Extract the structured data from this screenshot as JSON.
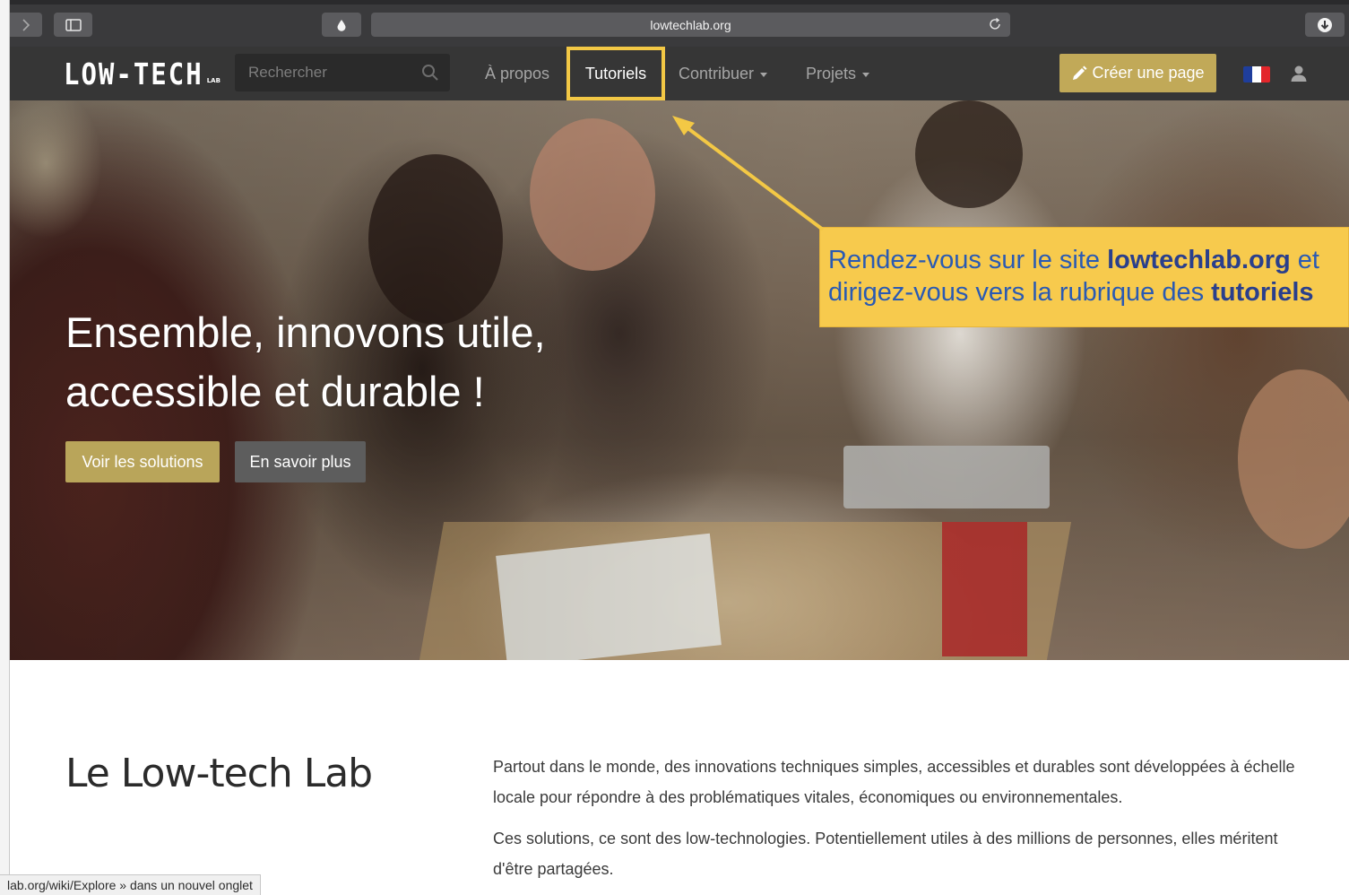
{
  "browser": {
    "url": "lowtechlab.org",
    "status_text": "lab.org/wiki/Explore » dans un nouvel onglet"
  },
  "header": {
    "logo_main": "LOW-TECH",
    "logo_sub": "LAB",
    "search_placeholder": "Rechercher",
    "nav": {
      "apropos": "À propos",
      "tutoriels": "Tutoriels",
      "contribuer": "Contribuer",
      "projets": "Projets"
    },
    "create_page": "Créer une page",
    "flag_colors": [
      "#1f3e9c",
      "#ffffff",
      "#e3262b"
    ]
  },
  "hero": {
    "title_line1": "Ensemble, innovons utile,",
    "title_line2": "accessible et durable !",
    "btn_solutions": "Voir les solutions",
    "btn_savoir": "En savoir plus"
  },
  "annotation": {
    "line1_prefix": "Rendez-vous sur le site ",
    "line1_bold": "lowtechlab.org",
    "line1_suffix": " et",
    "line2_prefix": "dirigez-vous vers la rubrique des ",
    "line2_bold": "tutoriels"
  },
  "section": {
    "title": "Le Low-tech Lab",
    "paragraph1": "Partout dans le monde, des innovations techniques simples, accessibles et durables sont développées à échelle locale pour répondre à des problématiques vitales, économiques ou environnementales.",
    "paragraph2": "Ces solutions, ce sont des low-technologies. Potentiellement utiles à des millions de personnes, elles méritent d'être partagées."
  },
  "colors": {
    "accent_gold": "#c1a958",
    "highlight_yellow": "#f3c845",
    "header_dark": "#363636"
  }
}
